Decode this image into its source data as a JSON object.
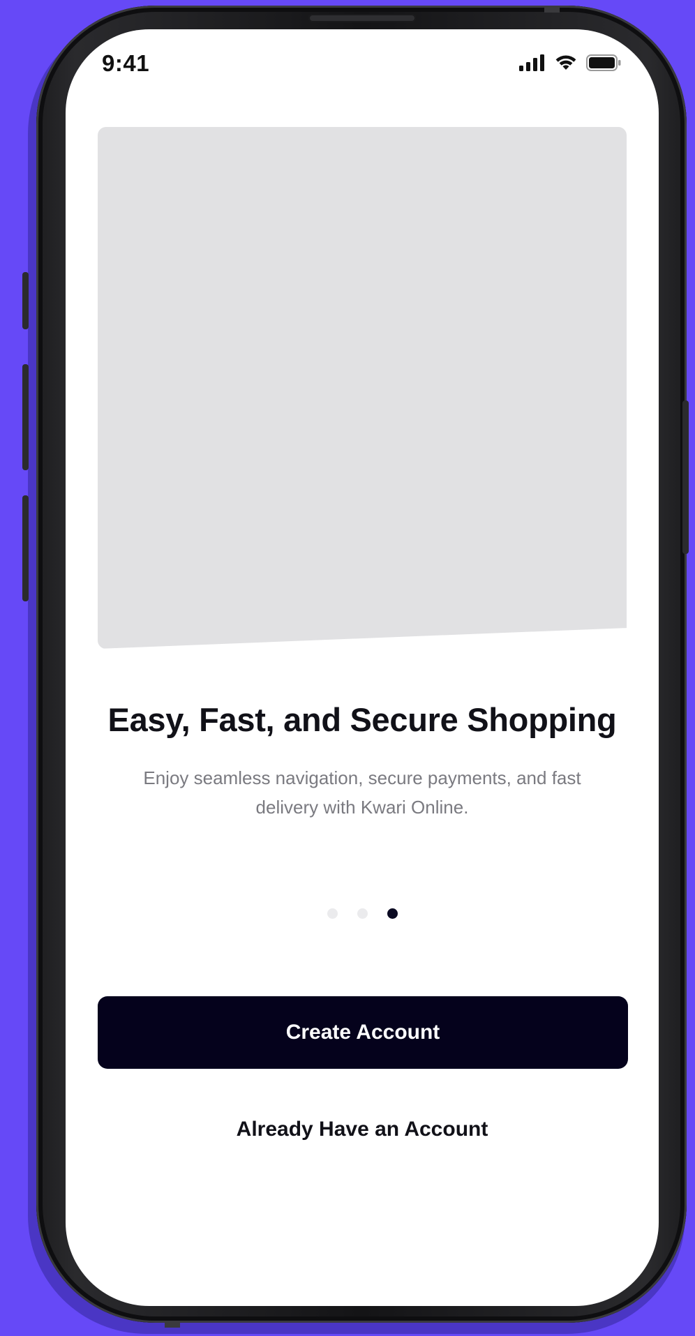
{
  "colors": {
    "background": "#6649F7",
    "button_primary": "#05021c",
    "image_placeholder": "#e1e1e3",
    "dot_active": "#0b0a22",
    "dot_inactive": "#ebebed"
  },
  "status_bar": {
    "time": "9:41",
    "icons": [
      "cellular-signal-icon",
      "wifi-icon",
      "battery-icon"
    ]
  },
  "onboarding": {
    "title": "Easy, Fast, and Secure Shopping",
    "description": "Enjoy seamless navigation, secure payments, and fast delivery with Kwari Online.",
    "page_count": 3,
    "current_page": 3
  },
  "actions": {
    "primary_label": "Create Account",
    "secondary_label": "Already Have an Account"
  }
}
